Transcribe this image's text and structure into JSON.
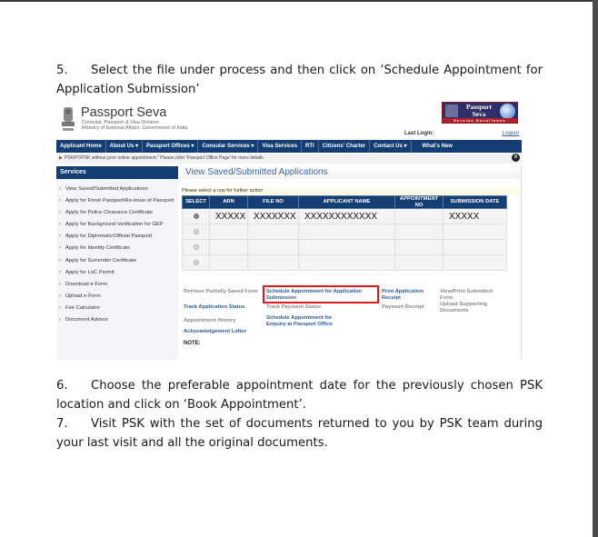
{
  "document": {
    "step5": {
      "num": "5.",
      "text": "Select the file under process and then click on ‘Schedule Appointment for Application Submission’"
    },
    "step6": {
      "num": "6.",
      "text": "Choose the preferable appointment date for the previously chosen PSK location and click on ‘Book Appointment’."
    },
    "step7": {
      "num": "7.",
      "text": "Visit PSK with the set of documents returned to you by PSK team during your last visit and all the original documents."
    }
  },
  "screenshot": {
    "header": {
      "brand": "Passport Seva",
      "subtitle1": "Consular, Passport & Visa Division",
      "subtitle2": "Ministry of External Affairs, Government of India",
      "logo_text": "Passport Seva",
      "logo_strip": "Service Excellence",
      "last_login_label": "Last Login:",
      "logout_label": "Logout"
    },
    "nav": [
      {
        "label": "Applicant Home"
      },
      {
        "label": "About Us ▾"
      },
      {
        "label": "Passport Offices ▾"
      },
      {
        "label": "Consular Services ▾"
      },
      {
        "label": "Visa Services"
      },
      {
        "label": "RTI"
      },
      {
        "label": "Citizens' Charter"
      },
      {
        "label": "Contact Us ▾"
      },
      {
        "label": "What's New"
      }
    ],
    "notice": "PSK/POPSK without prior online appointment.\" Please refer 'Passport Office Page' for more details.",
    "pause_icon": "pause-icon",
    "sidebar": {
      "title": "Services",
      "items": [
        {
          "label": "View Saved/Submitted Applications"
        },
        {
          "label": "Apply for Fresh Passport/Re-issue of Passport"
        },
        {
          "label": "Apply for Police Clearance Certificate"
        },
        {
          "label": "Apply for Background Verification for GEP"
        },
        {
          "label": "Apply for Diplomatic/Official Passport"
        },
        {
          "label": "Apply for Identity Certificate"
        },
        {
          "label": "Apply for Surrender Certificate"
        },
        {
          "label": "Apply for LoC Permit"
        },
        {
          "label": "Download e-Form"
        },
        {
          "label": "Upload e-Form"
        },
        {
          "label": "Fee Calculator"
        },
        {
          "label": "Document Advisor"
        }
      ]
    },
    "main": {
      "title": "View Saved/Submitted Applications",
      "instruction": "Please select a row for further action",
      "columns": [
        "SELECT",
        "ARN",
        "FILE NO",
        "APPLICANT NAME",
        "APPOINTMENT NO",
        "SUBMISSION DATE"
      ],
      "rows": [
        {
          "selected": true,
          "arn": "XXXXX",
          "file_no": "XXXXXXX",
          "name": "XXXXXXXXXXXX",
          "appt": "",
          "date": "XXXXX"
        },
        {
          "selected": false,
          "arn": "",
          "file_no": "",
          "name": "",
          "appt": "",
          "date": ""
        },
        {
          "selected": false,
          "arn": "",
          "file_no": "",
          "name": "",
          "appt": "",
          "date": ""
        },
        {
          "selected": false,
          "arn": "",
          "file_no": "",
          "name": "",
          "appt": "",
          "date": ""
        }
      ],
      "actions": {
        "retrieve": "Retrieve Partially Saved Form",
        "schedule_submission": "Schedule Appointment for Application Submission",
        "print_receipt": "Print Application Receipt",
        "view_print": "View/Print Submitted Form",
        "track_status": "Track Application Status",
        "track_payment": "Track Payment Status",
        "payment_receipt": "Payment Receipt",
        "upload_docs": "Upload Supporting Documents",
        "appt_history": "Appointment History",
        "schedule_enquiry": "Schedule Appointment for Enquiry at Passport Office",
        "ack_letter": "Acknowledgement Letter"
      },
      "note_label": "NOTE:"
    },
    "colors": {
      "nav_bg": "#133d73",
      "link_blue": "#2b5a94",
      "highlight_red": "#e01b1b"
    }
  }
}
